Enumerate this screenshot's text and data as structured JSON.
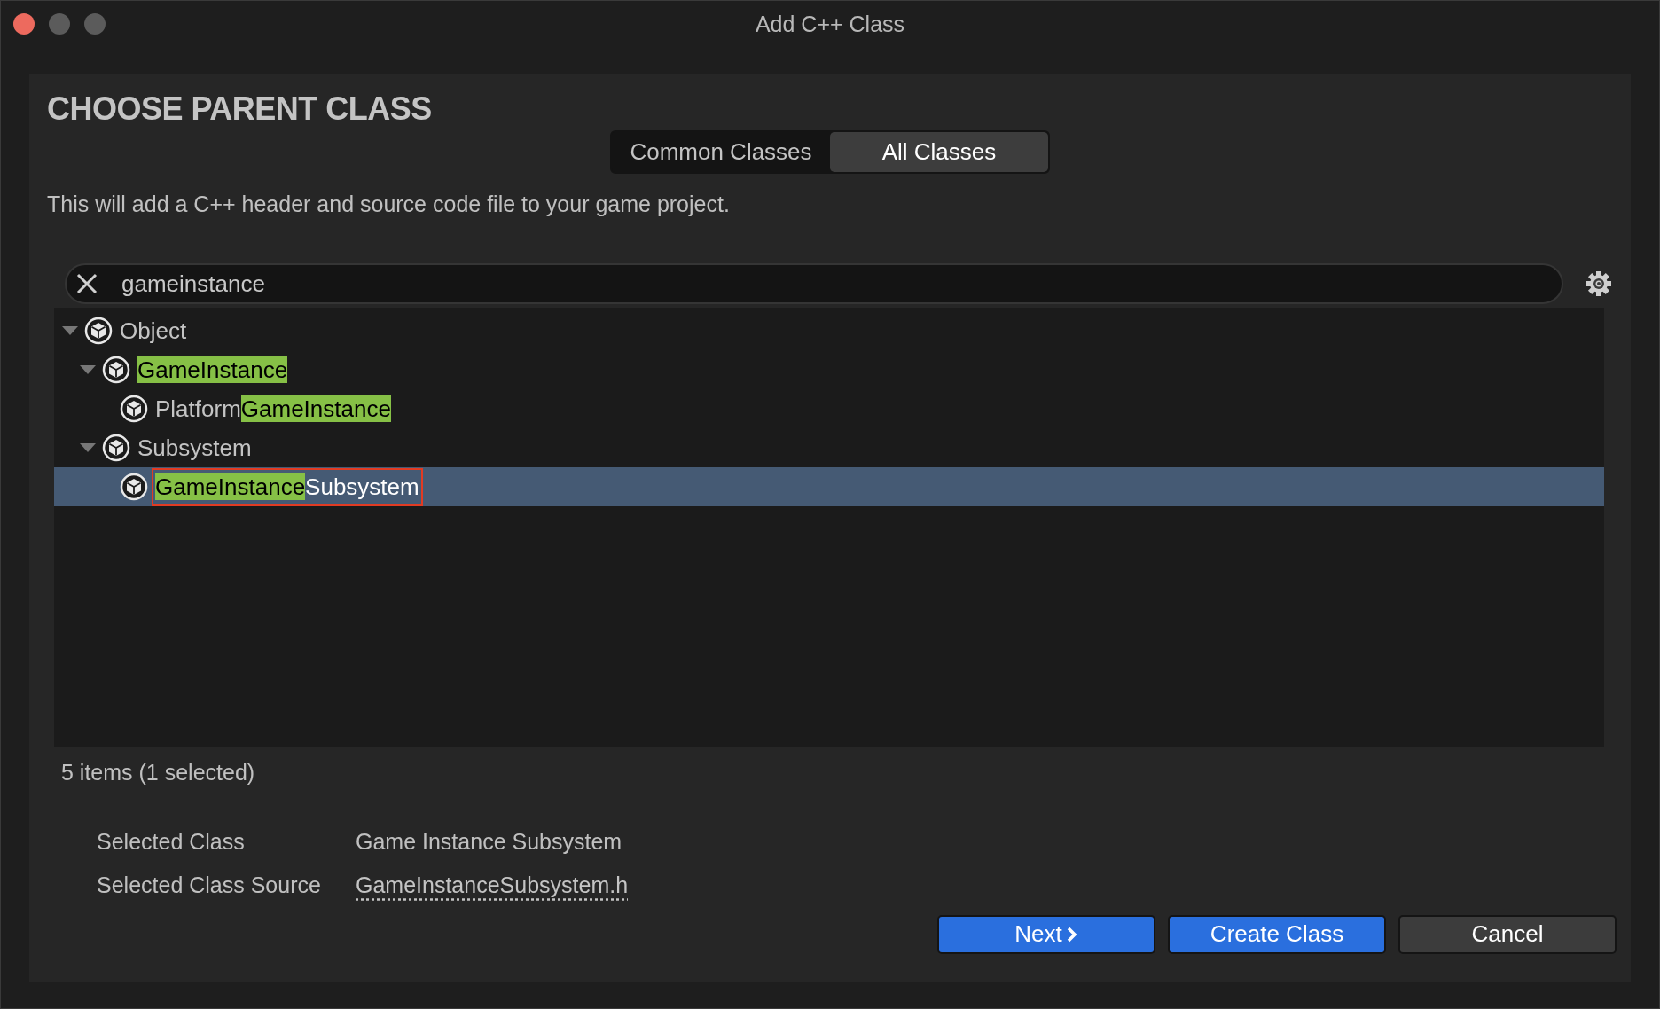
{
  "window": {
    "title": "Add C++ Class",
    "controls": [
      {
        "color": "#ed6a5e"
      },
      {
        "color": "#5b5b5b"
      },
      {
        "color": "#5b5b5b"
      }
    ]
  },
  "heading": "CHOOSE PARENT CLASS",
  "tabs": [
    {
      "label": "Common Classes",
      "selected": false
    },
    {
      "label": "All Classes",
      "selected": true
    }
  ],
  "description": "This will add a C++ header and source code file to your game project.",
  "search": {
    "value": "gameinstance"
  },
  "tree": [
    {
      "segments": [
        {
          "text": "Object",
          "highlight": false
        }
      ],
      "expanded": true,
      "selected": false,
      "outlined": false,
      "children": [
        {
          "segments": [
            {
              "text": "GameInstance",
              "highlight": true
            }
          ],
          "expanded": true,
          "selected": false,
          "outlined": false,
          "children": [
            {
              "segments": [
                {
                  "text": "Platform",
                  "highlight": false
                },
                {
                  "text": "GameInstance",
                  "highlight": true
                }
              ],
              "selected": false,
              "outlined": false
            }
          ]
        },
        {
          "segments": [
            {
              "text": "Subsystem",
              "highlight": false
            }
          ],
          "expanded": true,
          "selected": false,
          "outlined": false,
          "children": [
            {
              "segments": [
                {
                  "text": "GameInstance",
                  "highlight": true
                },
                {
                  "text": "Subsystem",
                  "highlight": false
                }
              ],
              "selected": true,
              "outlined": true
            }
          ]
        }
      ]
    }
  ],
  "status": "5 items (1 selected)",
  "details": [
    {
      "label": "Selected Class",
      "value": "Game Instance Subsystem",
      "kind": "text"
    },
    {
      "label": "Selected Class Source",
      "value": "GameInstanceSubsystem.h",
      "kind": "link"
    }
  ],
  "buttons": [
    {
      "label": "Next",
      "kind": "primary",
      "chevron": true
    },
    {
      "label": "Create Class",
      "kind": "primary",
      "chevron": false
    },
    {
      "label": "Cancel",
      "kind": "secondary",
      "chevron": false
    }
  ]
}
